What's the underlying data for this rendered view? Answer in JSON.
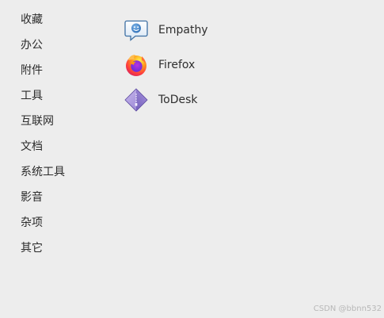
{
  "categories": [
    {
      "id": "favorites",
      "label": "收藏"
    },
    {
      "id": "office",
      "label": "办公"
    },
    {
      "id": "accessories",
      "label": "附件"
    },
    {
      "id": "tools",
      "label": "工具"
    },
    {
      "id": "internet",
      "label": "互联网"
    },
    {
      "id": "documents",
      "label": "文档"
    },
    {
      "id": "system-tools",
      "label": "系统工具"
    },
    {
      "id": "multimedia",
      "label": "影音"
    },
    {
      "id": "misc",
      "label": "杂项"
    },
    {
      "id": "other",
      "label": "其它"
    }
  ],
  "apps": [
    {
      "id": "empathy",
      "label": "Empathy",
      "icon": "empathy-chat-icon"
    },
    {
      "id": "firefox",
      "label": "Firefox",
      "icon": "firefox-icon"
    },
    {
      "id": "todesk",
      "label": "ToDesk",
      "icon": "todesk-diamond-icon"
    }
  ],
  "watermark": "CSDN @bbnn532",
  "colors": {
    "background": "#ededed",
    "text": "#2e2e2e",
    "watermark": "#b8b8b8"
  }
}
